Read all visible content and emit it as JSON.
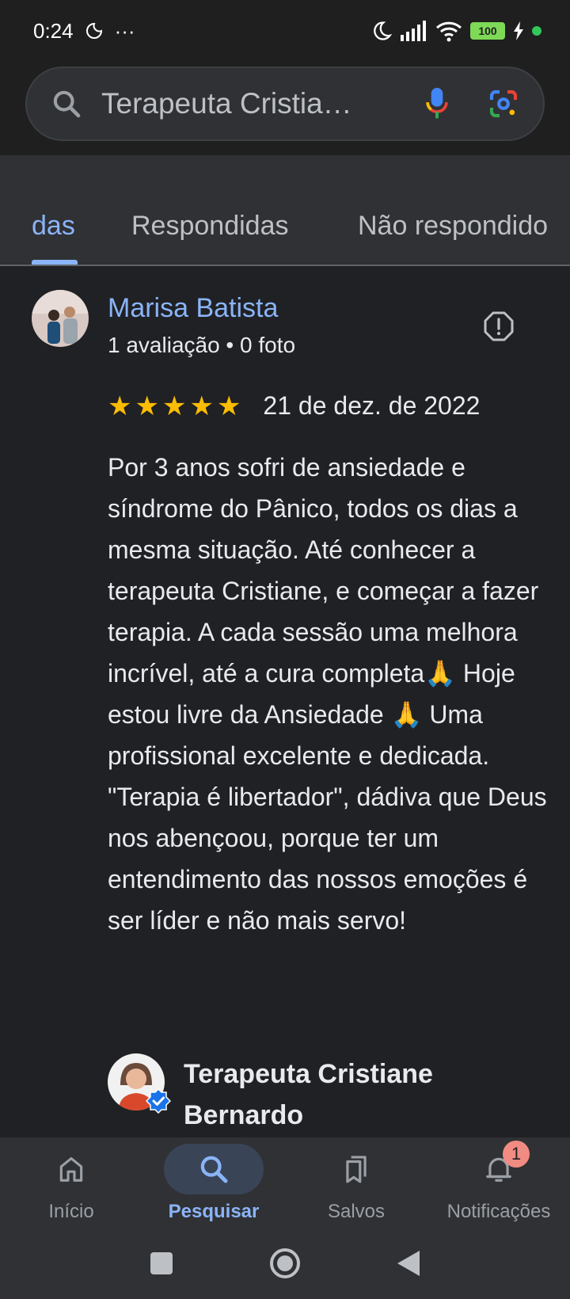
{
  "status_bar": {
    "time": "0:24",
    "dots": "···",
    "battery": "100"
  },
  "search": {
    "query": "Terapeuta Cristia…"
  },
  "tabs": [
    {
      "label": "das",
      "active": true
    },
    {
      "label": "Respondidas",
      "active": false
    },
    {
      "label": "Não respondido",
      "active": false
    }
  ],
  "review": {
    "reviewer_name": "Marisa Batista",
    "reviewer_meta": "1 avaliação • 0 foto",
    "stars": 5,
    "date": "21 de dez. de 2022",
    "text": "Por 3 anos sofri de ansiedade e síndrome do Pânico, todos os dias a mesma situação. Até conhecer a terapeuta Cristiane, e começar a fazer terapia. A cada sessão uma melhora incrível, até a cura completa🙏 Hoje estou livre da Ansiedade 🙏 Uma profissional excelente e dedicada. \"Terapia é libertador\", dádiva que Deus nos abençoou, porque ter um entendimento das nossos emoções é ser líder e não mais servo!",
    "owner_name": "Terapeuta Cristiane Bernardo"
  },
  "bottom_nav": {
    "items": [
      {
        "label": "Início",
        "icon": "home-icon"
      },
      {
        "label": "Pesquisar",
        "icon": "search-icon",
        "active": true
      },
      {
        "label": "Salvos",
        "icon": "bookmarks-icon"
      },
      {
        "label": "Notificações",
        "icon": "bell-icon",
        "badge": "1"
      }
    ]
  },
  "colors": {
    "background": "#202124",
    "accent": "#8ab4f8",
    "star": "#fbbc04"
  }
}
